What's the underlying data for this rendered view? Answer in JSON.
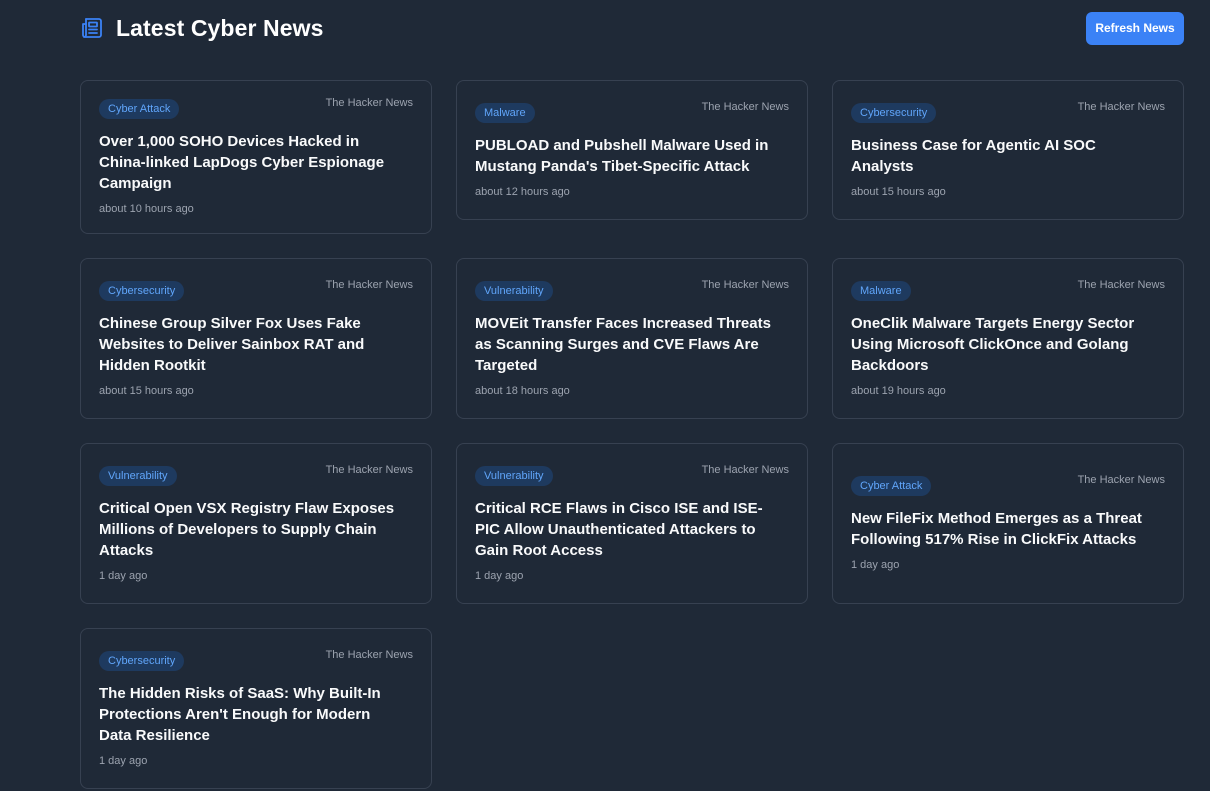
{
  "header": {
    "title": "Latest Cyber News",
    "icon": "newspaper-icon",
    "refresh_label": "Refresh News"
  },
  "colors": {
    "background": "#1f2937",
    "accent": "#3b82f6",
    "badge_bg": "#1e3a5f",
    "badge_text": "#60a5fa"
  },
  "articles": [
    {
      "category": "Cyber Attack",
      "source": "The Hacker News",
      "title": "Over 1,000 SOHO Devices Hacked in China-linked LapDogs Cyber Espionage Campaign",
      "time": "about 10 hours ago"
    },
    {
      "category": "Malware",
      "source": "The Hacker News",
      "title": "PUBLOAD and Pubshell Malware Used in Mustang Panda's Tibet-Specific Attack",
      "time": "about 12 hours ago"
    },
    {
      "category": "Cybersecurity",
      "source": "The Hacker News",
      "title": "Business Case for Agentic AI SOC Analysts",
      "time": "about 15 hours ago"
    },
    {
      "category": "Cybersecurity",
      "source": "The Hacker News",
      "title": "Chinese Group Silver Fox Uses Fake Websites to Deliver Sainbox RAT and Hidden Rootkit",
      "time": "about 15 hours ago"
    },
    {
      "category": "Vulnerability",
      "source": "The Hacker News",
      "title": "MOVEit Transfer Faces Increased Threats as Scanning Surges and CVE Flaws Are Targeted",
      "time": "about 18 hours ago"
    },
    {
      "category": "Malware",
      "source": "The Hacker News",
      "title": "OneClik Malware Targets Energy Sector Using Microsoft ClickOnce and Golang Backdoors",
      "time": "about 19 hours ago"
    },
    {
      "category": "Vulnerability",
      "source": "The Hacker News",
      "title": "Critical Open VSX Registry Flaw Exposes Millions of Developers to Supply Chain Attacks",
      "time": "1 day ago"
    },
    {
      "category": "Vulnerability",
      "source": "The Hacker News",
      "title": "Critical RCE Flaws in Cisco ISE and ISE-PIC Allow Unauthenticated Attackers to Gain Root Access",
      "time": "1 day ago"
    },
    {
      "category": "Cyber Attack",
      "source": "The Hacker News",
      "title": "New FileFix Method Emerges as a Threat Following 517% Rise in ClickFix Attacks",
      "time": "1 day ago"
    },
    {
      "category": "Cybersecurity",
      "source": "The Hacker News",
      "title": "The Hidden Risks of SaaS: Why Built-In Protections Aren't Enough for Modern Data Resilience",
      "time": "1 day ago"
    }
  ]
}
